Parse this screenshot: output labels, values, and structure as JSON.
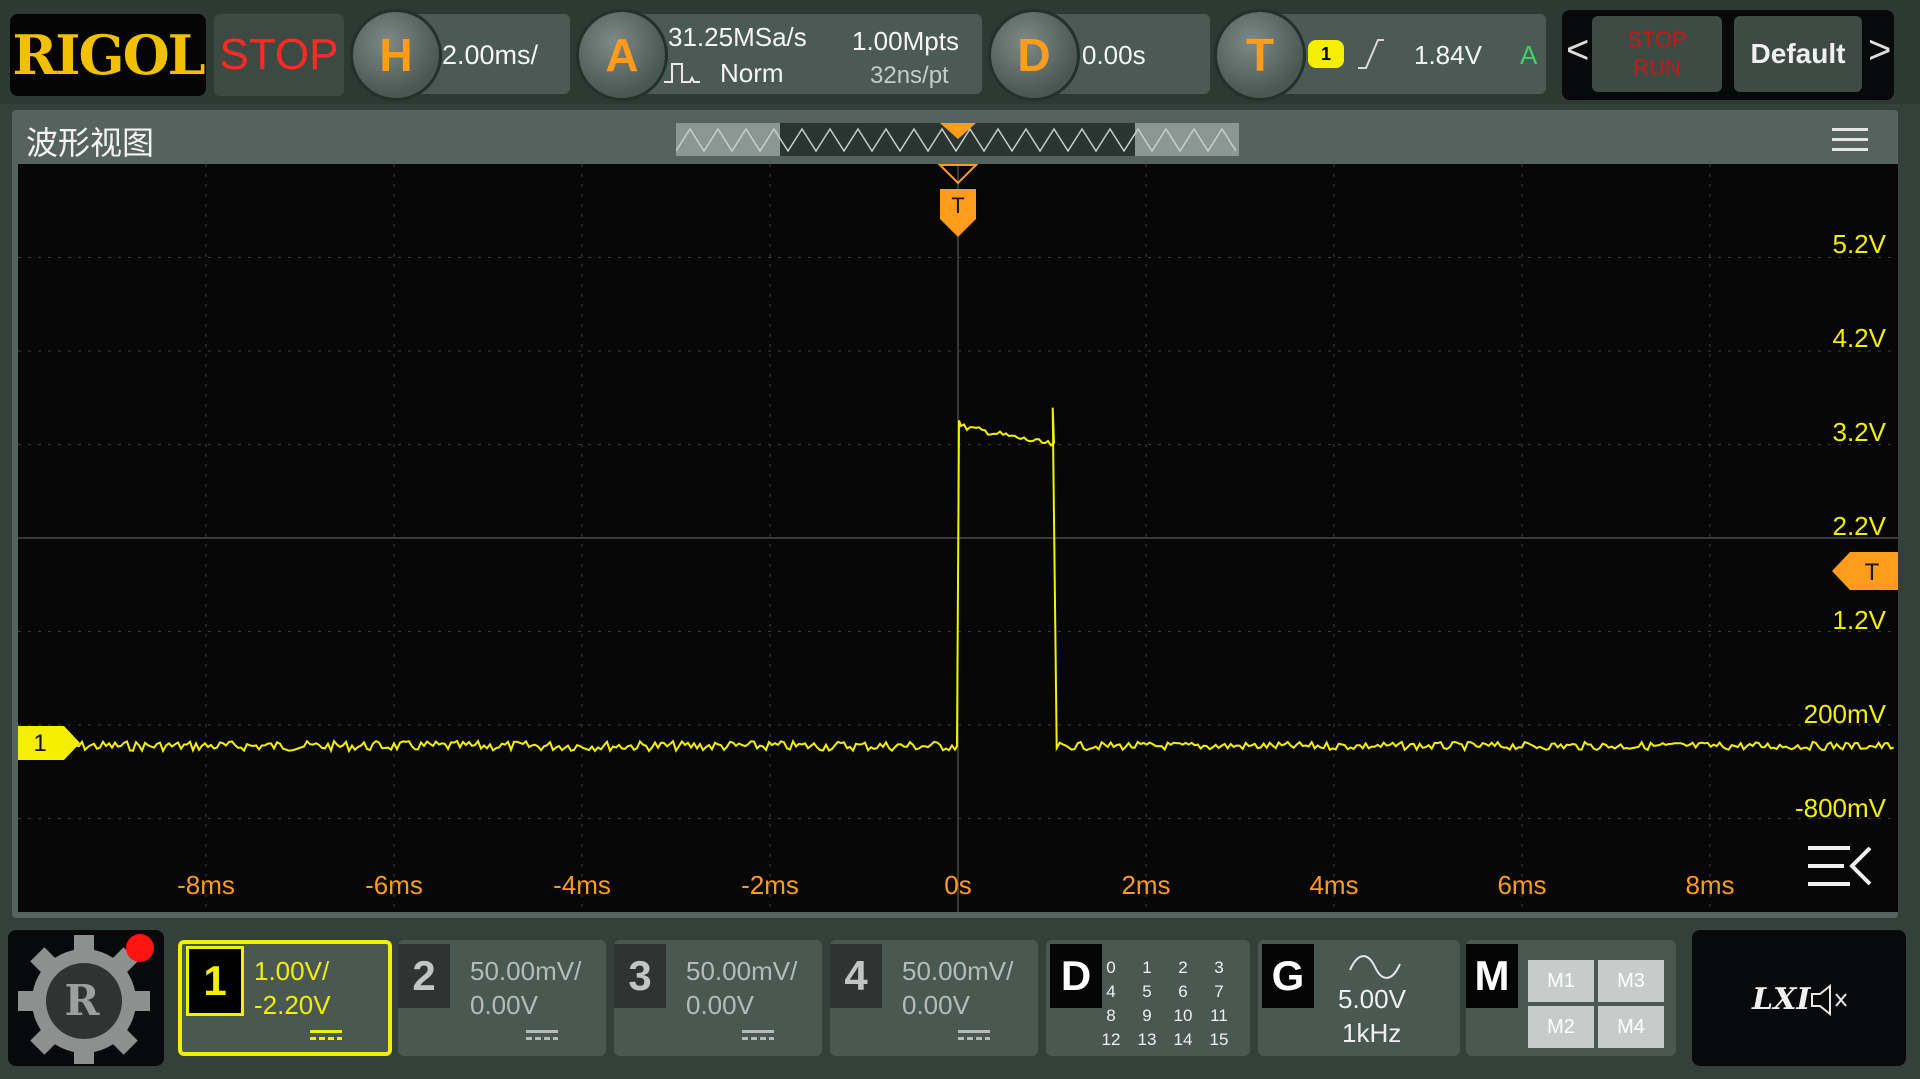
{
  "brand": "RIGOL",
  "run_state": "STOP",
  "horizontal": {
    "badge": "H",
    "scale": "2.00ms/"
  },
  "acquisition": {
    "badge": "A",
    "sample_rate": "31.25MSa/s",
    "memory_depth": "1.00Mpts",
    "mode": "Norm",
    "time_per_point": "32ns/pt"
  },
  "delay": {
    "badge": "D",
    "value": "0.00s"
  },
  "trigger": {
    "badge": "T",
    "source_channel": "1",
    "slope": "rising",
    "level": "1.84V",
    "mode_letter": "A"
  },
  "toolbar": {
    "prev": "<",
    "next": ">",
    "stop_label": "STOP",
    "run_label": "RUN",
    "default_label": "Default"
  },
  "waveform_view": {
    "title": "波形视图",
    "trigger_marker": "T",
    "channel_marker": "1",
    "trigger_level_marker": "T",
    "y_labels": [
      "5.2V",
      "4.2V",
      "3.2V",
      "2.2V",
      "1.2V",
      "200mV",
      "-800mV"
    ],
    "x_labels": [
      "-8ms",
      "-6ms",
      "-4ms",
      "-2ms",
      "0s",
      "2ms",
      "4ms",
      "6ms",
      "8ms"
    ]
  },
  "trace": {
    "color": "#f5f000",
    "baseline_v": 0.0,
    "pulse_start_ms": 0.0,
    "pulse_end_ms": 1.05,
    "pulse_top_start_v": 3.4,
    "pulse_top_end_v": 3.2,
    "spike_v": 3.6
  },
  "channels": [
    {
      "num": "1",
      "scale": "1.00V/",
      "offset": "-2.20V",
      "active": true,
      "color": "#f5ee00"
    },
    {
      "num": "2",
      "scale": "50.00mV/",
      "offset": "0.00V",
      "active": false,
      "color": "#c0c6c3"
    },
    {
      "num": "3",
      "scale": "50.00mV/",
      "offset": "0.00V",
      "active": false,
      "color": "#c0c6c3"
    },
    {
      "num": "4",
      "scale": "50.00mV/",
      "offset": "0.00V",
      "active": false,
      "color": "#c0c6c3"
    }
  ],
  "digital": {
    "label": "D",
    "numbers": [
      "0",
      "1",
      "2",
      "3",
      "4",
      "5",
      "6",
      "7",
      "8",
      "9",
      "10",
      "11",
      "12",
      "13",
      "14",
      "15"
    ]
  },
  "generator": {
    "label": "G",
    "amplitude": "5.00V",
    "frequency": "1kHz",
    "icon": "sine-wave-icon"
  },
  "math": {
    "label": "M",
    "buttons": [
      "M1",
      "M3",
      "M2",
      "M4"
    ]
  },
  "status": {
    "lxi": "LXI",
    "icon": "speaker-muted-icon"
  },
  "colors": {
    "trace": "#f5f000",
    "accent": "#ff9c1c",
    "stop": "#ff2a24"
  }
}
